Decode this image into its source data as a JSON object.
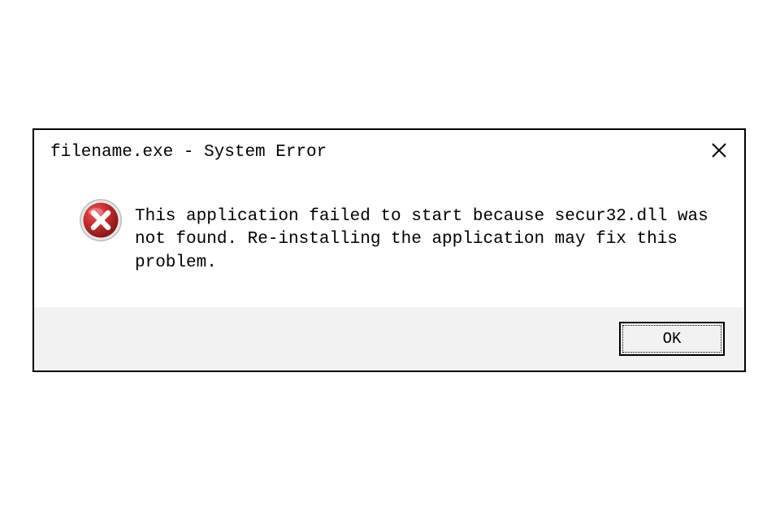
{
  "dialog": {
    "title": "filename.exe - System Error",
    "message": "This application failed to start because secur32.dll was not found. Re-installing the application may fix this problem.",
    "ok_label": "OK"
  },
  "colors": {
    "error_red": "#c62828",
    "error_red_dark": "#8a1a1a",
    "error_highlight": "#f7b2b2"
  }
}
